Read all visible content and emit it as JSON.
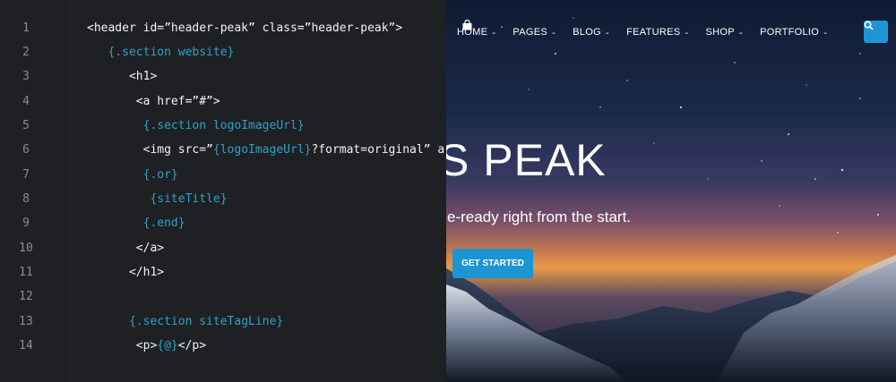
{
  "nav": {
    "items": [
      {
        "label": "HOME"
      },
      {
        "label": "PAGES"
      },
      {
        "label": "BLOG"
      },
      {
        "label": "FEATURES"
      },
      {
        "label": "SHOP"
      },
      {
        "label": "PORTFOLIO"
      }
    ],
    "caret": "⌄"
  },
  "hero": {
    "title": "S PEAK",
    "subtitle": "bile-ready right from the start.",
    "cta": "GET STARTED"
  },
  "colors": {
    "accent": "#1d95d2",
    "editor_bg": "#1f2023",
    "template_blue": "#2aa3c8"
  },
  "editor": {
    "lines": [
      {
        "n": "1",
        "parts": [
          {
            "t": "<header id=”header-peak” class=”header-peak”>",
            "c": "tag"
          }
        ]
      },
      {
        "n": "2",
        "parts": [
          {
            "t": "   ",
            "c": "tag"
          },
          {
            "t": "{.section website}",
            "c": "tpl"
          }
        ]
      },
      {
        "n": "3",
        "parts": [
          {
            "t": "      <h1>",
            "c": "tag"
          }
        ]
      },
      {
        "n": "4",
        "parts": [
          {
            "t": "       <a href=”#”>",
            "c": "tag"
          }
        ]
      },
      {
        "n": "5",
        "parts": [
          {
            "t": "        ",
            "c": "tag"
          },
          {
            "t": "{.section logoImageUrl}",
            "c": "tpl"
          }
        ]
      },
      {
        "n": "6",
        "parts": [
          {
            "t": "        <img src=”",
            "c": "tag"
          },
          {
            "t": "{logoImageUrl}",
            "c": "tpl"
          },
          {
            "t": "?format=original” a",
            "c": "tag"
          }
        ]
      },
      {
        "n": "7",
        "parts": [
          {
            "t": "        ",
            "c": "tag"
          },
          {
            "t": "{.or}",
            "c": "tpl"
          }
        ]
      },
      {
        "n": "8",
        "parts": [
          {
            "t": "         ",
            "c": "tag"
          },
          {
            "t": "{siteTitle}",
            "c": "tpl"
          }
        ]
      },
      {
        "n": "9",
        "parts": [
          {
            "t": "        ",
            "c": "tag"
          },
          {
            "t": "{.end}",
            "c": "tpl"
          }
        ]
      },
      {
        "n": "10",
        "parts": [
          {
            "t": "       </a>",
            "c": "tag"
          }
        ]
      },
      {
        "n": "11",
        "parts": [
          {
            "t": "      </h1>",
            "c": "tag"
          }
        ]
      },
      {
        "n": "12",
        "parts": []
      },
      {
        "n": "13",
        "parts": [
          {
            "t": "      ",
            "c": "tag"
          },
          {
            "t": "{.section siteTagLine}",
            "c": "tpl"
          }
        ]
      },
      {
        "n": "14",
        "parts": [
          {
            "t": "       <p>",
            "c": "tag"
          },
          {
            "t": "{@}",
            "c": "tpl"
          },
          {
            "t": "</p>",
            "c": "tag"
          }
        ]
      }
    ]
  }
}
